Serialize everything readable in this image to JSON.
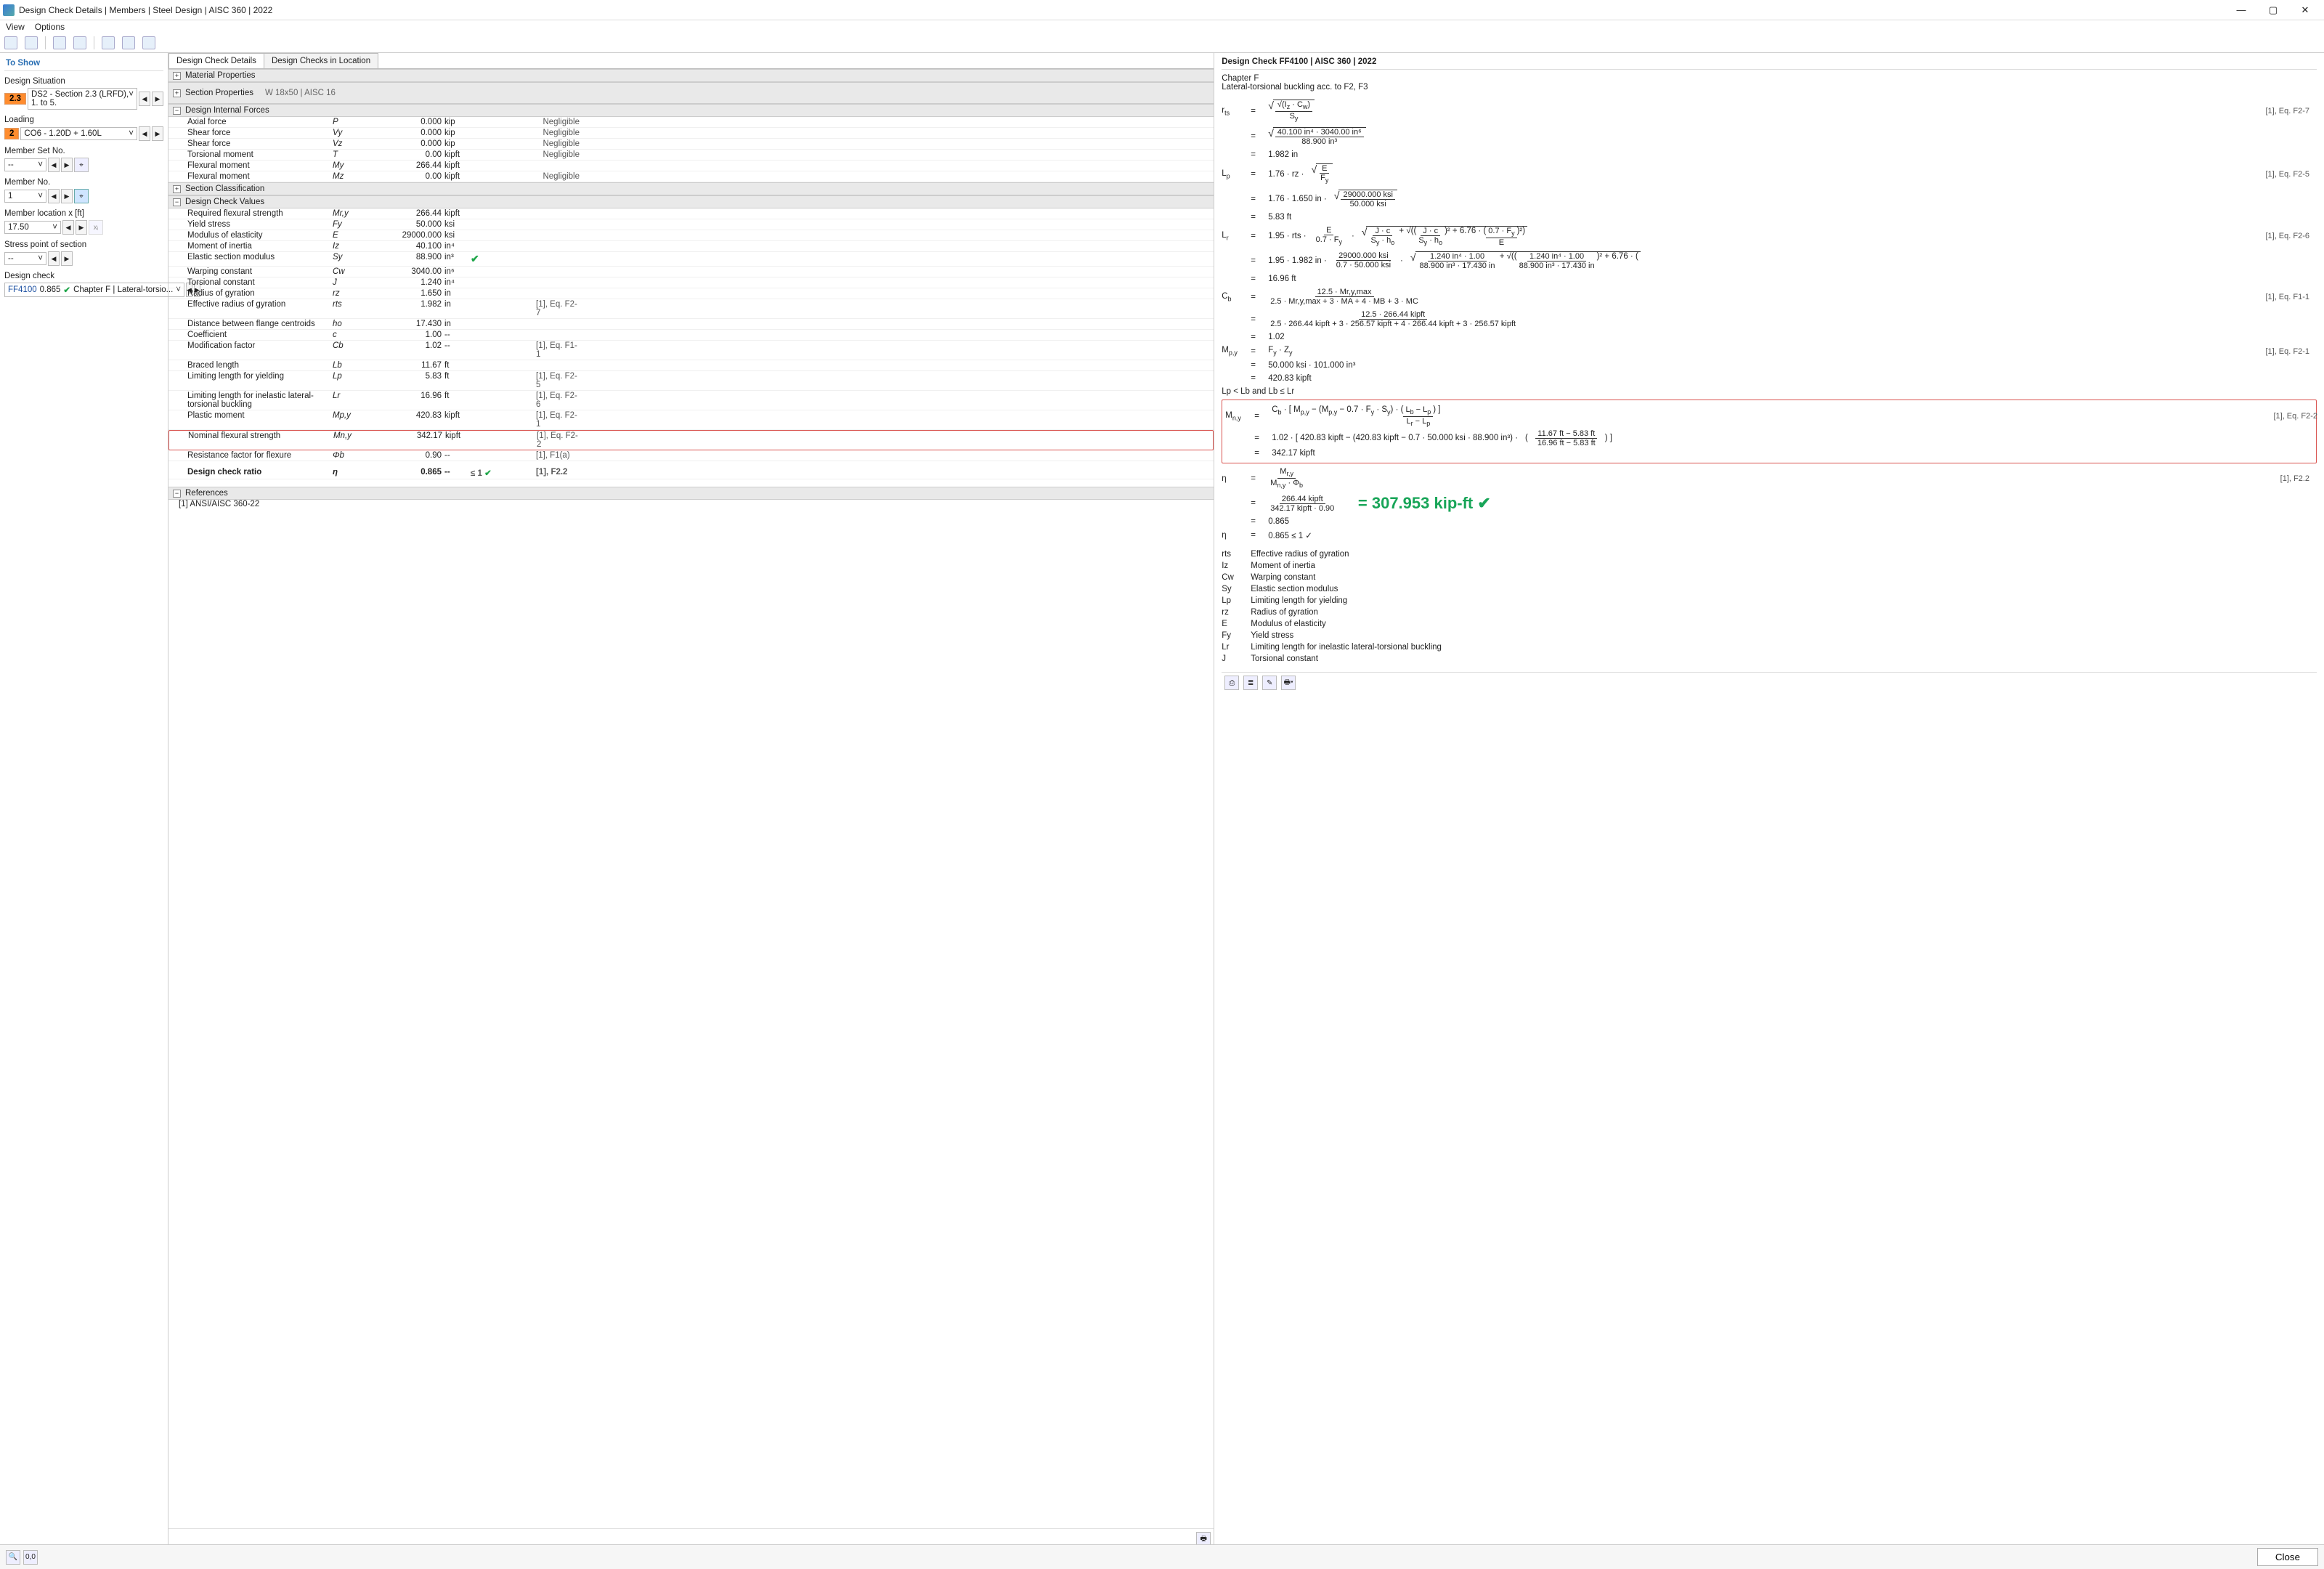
{
  "window": {
    "title": "Design Check Details | Members | Steel Design | AISC 360 | 2022",
    "menu": {
      "view": "View",
      "options": "Options"
    }
  },
  "left": {
    "toshow": "To Show",
    "designSituation": {
      "label": "Design Situation",
      "badge": "2.3",
      "text": "DS2 - Section 2.3 (LRFD), 1. to 5."
    },
    "loading": {
      "label": "Loading",
      "badge": "2",
      "text": "CO6 - 1.20D + 1.60L"
    },
    "memberSet": {
      "label": "Member Set No.",
      "value": "-- "
    },
    "memberNo": {
      "label": "Member No.",
      "value": "1"
    },
    "memberLoc": {
      "label": "Member location x [ft]",
      "value": "17.50"
    },
    "stressPoint": {
      "label": "Stress point of section",
      "value": "-- "
    },
    "designCheck": {
      "label": "Design check",
      "id": "FF4100",
      "ratio": "0.865",
      "desc": "Chapter F | Lateral-torsio..."
    }
  },
  "tabs": {
    "t1": "Design Check Details",
    "t2": "Design Checks in Location"
  },
  "sections": {
    "matProp": "Material Properties",
    "secProp": "Section Properties",
    "secPropR": "W 18x50 | AISC 16",
    "dif": "Design Internal Forces",
    "secClass": "Section Classification",
    "dcv": "Design Check Values",
    "refs": "References",
    "ref1": "[1]  ANSI/AISC 360-22"
  },
  "dif": [
    {
      "n": "Axial force",
      "s": "P",
      "v": "0.000",
      "u": "kip",
      "r": "Negligible"
    },
    {
      "n": "Shear force",
      "s": "Vy",
      "v": "0.000",
      "u": "kip",
      "r": "Negligible"
    },
    {
      "n": "Shear force",
      "s": "Vz",
      "v": "0.000",
      "u": "kip",
      "r": "Negligible"
    },
    {
      "n": "Torsional moment",
      "s": "T",
      "v": "0.00",
      "u": "kipft",
      "r": "Negligible"
    },
    {
      "n": "Flexural moment",
      "s": "My",
      "v": "266.44",
      "u": "kipft",
      "r": ""
    },
    {
      "n": "Flexural moment",
      "s": "Mz",
      "v": "0.00",
      "u": "kipft",
      "r": "Negligible"
    }
  ],
  "dcv": [
    {
      "n": "Required flexural strength",
      "s": "Mr,y",
      "v": "266.44",
      "u": "kipft",
      "r": ""
    },
    {
      "n": "Yield stress",
      "s": "Fy",
      "v": "50.000",
      "u": "ksi",
      "r": ""
    },
    {
      "n": "Modulus of elasticity",
      "s": "E",
      "v": "29000.000",
      "u": "ksi",
      "r": ""
    },
    {
      "n": "Moment of inertia",
      "s": "Iz",
      "v": "40.100",
      "u": "in⁴",
      "r": ""
    },
    {
      "n": "Elastic section modulus",
      "s": "Sy",
      "v": "88.900",
      "u": "in³",
      "r": "",
      "chk": true
    },
    {
      "n": "Warping constant",
      "s": "Cw",
      "v": "3040.00",
      "u": "in⁶",
      "r": ""
    },
    {
      "n": "Torsional constant",
      "s": "J",
      "v": "1.240",
      "u": "in⁴",
      "r": ""
    },
    {
      "n": "Radius of gyration",
      "s": "rz",
      "v": "1.650",
      "u": "in",
      "r": ""
    },
    {
      "n": "Effective radius of gyration",
      "s": "rts",
      "v": "1.982",
      "u": "in",
      "r": "[1], Eq. F2-7"
    },
    {
      "n": "Distance between flange centroids",
      "s": "ho",
      "v": "17.430",
      "u": "in",
      "r": ""
    },
    {
      "n": "Coefficient",
      "s": "c",
      "v": "1.00",
      "u": "--",
      "r": ""
    },
    {
      "n": "Modification factor",
      "s": "Cb",
      "v": "1.02",
      "u": "--",
      "r": "[1], Eq. F1-1"
    },
    {
      "n": "Braced length",
      "s": "Lb",
      "v": "11.67",
      "u": "ft",
      "r": ""
    },
    {
      "n": "Limiting length for yielding",
      "s": "Lp",
      "v": "5.83",
      "u": "ft",
      "r": "[1], Eq. F2-5"
    },
    {
      "n": "Limiting length for inelastic lateral-torsional buckling",
      "s": "Lr",
      "v": "16.96",
      "u": "ft",
      "r": "[1], Eq. F2-6"
    },
    {
      "n": "Plastic moment",
      "s": "Mp,y",
      "v": "420.83",
      "u": "kipft",
      "r": "[1], Eq. F2-1"
    },
    {
      "n": "Nominal flexural strength",
      "s": "Mn,y",
      "v": "342.17",
      "u": "kipft",
      "r": "[1], Eq. F2-2",
      "hl": true
    },
    {
      "n": "Resistance factor for flexure",
      "s": "Φb",
      "v": "0.90",
      "u": "--",
      "r": "[1], F1(a)"
    }
  ],
  "dcr": {
    "n": "Design check ratio",
    "s": "η",
    "v": "0.865",
    "u": "--",
    "lim": "≤ 1",
    "r": "[1], F2.2"
  },
  "right": {
    "title": "Design Check FF4100 | AISC 360 | 2022",
    "chapter": "Chapter F",
    "sub": "Lateral-torsional buckling acc. to F2, F3",
    "refs": {
      "f27": "[1], Eq. F2-7",
      "f25": "[1], Eq. F2-5",
      "f26": "[1], Eq. F2-6",
      "f11": "[1], Eq. F1-1",
      "f21": "[1], Eq. F2-1",
      "f22e": "[1], Eq. F2-2",
      "f22": "[1], F2.2"
    },
    "vals": {
      "rts1": "40.100 in⁴  ·  3040.00 in⁶",
      "rts2": "88.900 in³",
      "rts": "1.982 in",
      "lp1": "29000.000 ksi",
      "lp2": "50.000 ksi",
      "lp3": "1.76  ·  1.650 in  ·",
      "lp": "5.83 ft",
      "lr1": "1.95  ·  1.982 in  ·",
      "lr2": "29000.000 ksi",
      "lr3": "0.7  ·  50.000 ksi",
      "lr4": "1.240 in⁴  ·  1.00",
      "lr5": "88.900 in³  ·  17.430 in",
      "lr6": "6.76  ·",
      "lr": "16.96 ft",
      "cb1": "12.5  ·  266.44 kipft",
      "cb2": "2.5 · 266.44 kipft  +  3 · 256.57 kipft  +  4 · 266.44 kipft  +  3 · 256.57 kipft",
      "cb": "1.02",
      "mp1": "50.000 ksi  ·  101.000 in³",
      "mp": "420.83 kipft",
      "mn_line1": "1.02  ·  [ 420.83 kipft  −  (420.83 kipft  −  0.7  ·  50.000 ksi  ·  88.900 in³)  ·",
      "mn_f1t": "11.67 ft  −  5.83 ft",
      "mn_f1b": "16.96 ft  −  5.83 ft",
      "mn": "342.17 kipft",
      "eta_t": "266.44 kipft",
      "eta_b": "342.17 kipft  ·  0.90",
      "eta": "0.865",
      "etalim": "0.865  ≤ 1 ✓",
      "annot": "= 307.953 kip-ft ✔",
      "cond": "Lp  <  Lb  and  Lb  ≤  Lr",
      "cbsym1": "12.5  ·  Mr,y,max",
      "cbsym2": "2.5 · Mr,y,max  +  3 · MA  +  4 · MB  +  3 · MC",
      "lpform": "1.76  ·  rz  ·",
      "lrform": "1.95  ·  rts  ·"
    },
    "symtab": [
      {
        "s": "rts",
        "d": "Effective radius of gyration"
      },
      {
        "s": "Iz",
        "d": "Moment of inertia"
      },
      {
        "s": "Cw",
        "d": "Warping constant"
      },
      {
        "s": "Sy",
        "d": "Elastic section modulus"
      },
      {
        "s": "Lp",
        "d": "Limiting length for yielding"
      },
      {
        "s": "rz",
        "d": "Radius of gyration"
      },
      {
        "s": "E",
        "d": "Modulus of elasticity"
      },
      {
        "s": "Fy",
        "d": "Yield stress"
      },
      {
        "s": "Lr",
        "d": "Limiting length for inelastic lateral-torsional buckling"
      },
      {
        "s": "J",
        "d": "Torsional constant"
      }
    ]
  },
  "footer": {
    "close": "Close"
  }
}
